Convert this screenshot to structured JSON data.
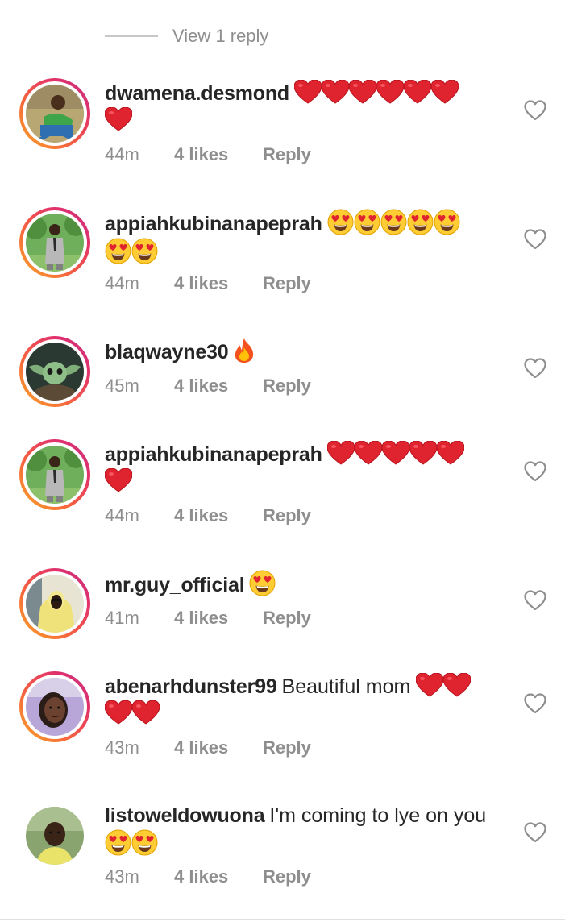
{
  "thread": {
    "view_replies_label": "View 1 reply"
  },
  "comments": [
    {
      "username": "dwamena.desmond",
      "text": "",
      "emojis": [
        "red-heart",
        "red-heart",
        "red-heart",
        "red-heart",
        "red-heart",
        "red-heart",
        "red-heart"
      ],
      "time": "44m",
      "likes": "4 likes",
      "reply_label": "Reply",
      "story_ring": true
    },
    {
      "username": "appiahkubinanapeprah",
      "text": "",
      "emojis": [
        "heart-eyes",
        "heart-eyes",
        "heart-eyes",
        "heart-eyes",
        "heart-eyes",
        "heart-eyes",
        "heart-eyes"
      ],
      "time": "44m",
      "likes": "4 likes",
      "reply_label": "Reply",
      "story_ring": true
    },
    {
      "username": "blaqwayne30",
      "text": "",
      "emojis": [
        "fire"
      ],
      "time": "45m",
      "likes": "4 likes",
      "reply_label": "Reply",
      "story_ring": true
    },
    {
      "username": "appiahkubinanapeprah",
      "text": "",
      "emojis": [
        "red-heart",
        "red-heart",
        "red-heart",
        "red-heart",
        "red-heart",
        "red-heart"
      ],
      "time": "44m",
      "likes": "4 likes",
      "reply_label": "Reply",
      "story_ring": true
    },
    {
      "username": "mr.guy_official",
      "text": "",
      "emojis": [
        "heart-eyes"
      ],
      "time": "41m",
      "likes": "4 likes",
      "reply_label": "Reply",
      "story_ring": true
    },
    {
      "username": "abenarhdunster99",
      "text": "Beautiful mom",
      "emojis": [
        "red-heart",
        "red-heart",
        "red-heart",
        "red-heart"
      ],
      "time": "43m",
      "likes": "4 likes",
      "reply_label": "Reply",
      "story_ring": true
    },
    {
      "username": "listoweldowuona",
      "text": "I'm coming to lye on you",
      "emojis": [
        "heart-eyes",
        "heart-eyes"
      ],
      "time": "43m",
      "likes": "4 likes",
      "reply_label": "Reply",
      "story_ring": false
    }
  ],
  "colors": {
    "primary_text": "#262626",
    "secondary_text": "#8e8e8e",
    "heart_red": "#e0242f",
    "story_ring_start": "#f9a825",
    "story_ring_end": "#c13584"
  },
  "icons": {
    "like": "heart-outline-icon",
    "heart_emoji": "red-heart-emoji",
    "heart_eyes_emoji": "heart-eyes-emoji",
    "fire_emoji": "fire-emoji"
  }
}
